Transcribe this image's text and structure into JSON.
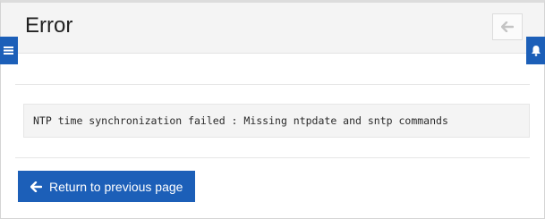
{
  "header": {
    "title": "Error",
    "back_icon": "arrow-left-icon"
  },
  "side_tabs": {
    "left_icon": "hamburger-menu-icon",
    "right_icon": "bell-icon"
  },
  "message": {
    "text": "NTP time synchronization failed : Missing ntpdate and sntp commands"
  },
  "actions": {
    "return_label": "Return to previous page",
    "return_icon": "arrow-left-icon"
  },
  "colors": {
    "accent": "#1c5fb8",
    "header_bg": "#f4f4f4",
    "message_bg": "#f4f4f4"
  }
}
